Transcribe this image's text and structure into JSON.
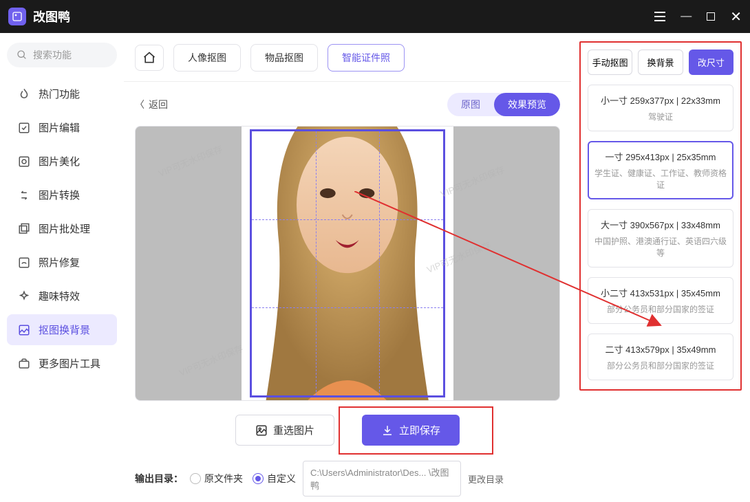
{
  "app": {
    "name": "改图鸭"
  },
  "search": {
    "placeholder": "搜索功能"
  },
  "sidebar": {
    "items": [
      {
        "label": "热门功能"
      },
      {
        "label": "图片编辑"
      },
      {
        "label": "图片美化"
      },
      {
        "label": "图片转换"
      },
      {
        "label": "图片批处理"
      },
      {
        "label": "照片修复"
      },
      {
        "label": "趣味特效"
      },
      {
        "label": "抠图换背景"
      },
      {
        "label": "更多图片工具"
      }
    ]
  },
  "tabs": {
    "portrait": "人像抠图",
    "object": "物品抠图",
    "idphoto": "智能证件照"
  },
  "back": "返回",
  "viewToggle": {
    "original": "原图",
    "preview": "效果预览"
  },
  "watermark_text": "VIP可无水印保存",
  "actions": {
    "reselect": "重选图片",
    "save": "立即保存"
  },
  "output": {
    "label": "输出目录：",
    "opt_source": "原文件夹",
    "opt_custom": "自定义",
    "path": "C:\\Users\\Administrator\\Des... \\改图鸭",
    "change": "更改目录"
  },
  "rightPanel": {
    "tabs": {
      "manual": "手动抠图",
      "changebg": "换背景",
      "resize": "改尺寸"
    },
    "sizes": [
      {
        "title": "小一寸 259x377px | 22x33mm",
        "sub": "驾驶证"
      },
      {
        "title": "一寸 295x413px | 25x35mm",
        "sub": "学生证、健康证、工作证、教师资格证"
      },
      {
        "title": "大一寸 390x567px | 33x48mm",
        "sub": "中国护照、港澳通行证、英语四六级等"
      },
      {
        "title": "小二寸 413x531px | 35x45mm",
        "sub": "部分公务员和部分国家的签证"
      },
      {
        "title": "二寸 413x579px | 35x49mm",
        "sub": "部分公务员和部分国家的签证"
      }
    ]
  }
}
